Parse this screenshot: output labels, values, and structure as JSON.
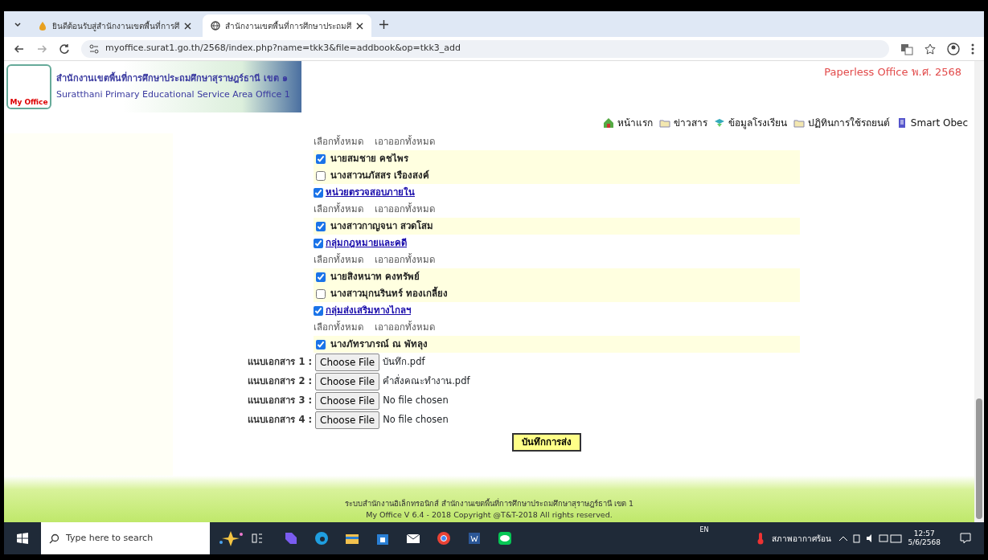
{
  "browser": {
    "tabs": [
      {
        "title": "ยินดีต้อนรับสู่สำนักงานเขตพื้นที่การศึ",
        "selected": false
      },
      {
        "title": "สำนักงานเขตพื้นที่การศึกษาประถมศึ",
        "selected": true
      }
    ],
    "url": "myoffice.surat1.go.th/2568/index.php?name=tkk3&file=addbook&op=tkk3_add"
  },
  "header": {
    "logo_text": "My Office",
    "title_th": "สำนักงานเขตพื้นที่การศึกษาประถมศึกษาสุราษฎร์ธานี เขต ๑",
    "title_en": "Suratthani Primary Educational Service Area Office 1",
    "tagline": "Paperless Office พ.ศ. 2568",
    "nav": [
      {
        "label": "หน้าแรก",
        "kind": "home"
      },
      {
        "label": "ข่าวสาร",
        "kind": "folder"
      },
      {
        "label": "ข้อมูลโรงเรียน",
        "kind": "globe"
      },
      {
        "label": "ปฏิทินการใช้รถยนต์",
        "kind": "folder"
      },
      {
        "label": "Smart Obec",
        "kind": "doc"
      }
    ]
  },
  "groups": [
    {
      "select_all": "เลือกทั้งหมด",
      "deselect_all": "เอาออกทั้งหมด",
      "members": [
        {
          "name": "นายสมชาย คชไพร",
          "checked": true
        },
        {
          "name": "นางสาวนภัสสร เรืองสงค์",
          "checked": false
        }
      ]
    },
    {
      "name": "หน่วยตรวจสอบภายใน",
      "checked": true,
      "select_all": "เลือกทั้งหมด",
      "deselect_all": "เอาออกทั้งหมด",
      "members": [
        {
          "name": "นางสาวกาญจนา สวดโสม",
          "checked": true
        }
      ]
    },
    {
      "name": "กลุ่มกฎหมายและคดี",
      "checked": true,
      "select_all": "เลือกทั้งหมด",
      "deselect_all": "เอาออกทั้งหมด",
      "members": [
        {
          "name": "นายสิงหนาท คงทรัพย์",
          "checked": true
        },
        {
          "name": "นางสาวมุกนรินทร์ ทองเกลี้ยง",
          "checked": false
        }
      ]
    },
    {
      "name": "กลุ่มส่งเสริมทางไกลฯ",
      "checked": true,
      "select_all": "เลือกทั้งหมด",
      "deselect_all": "เอาออกทั้งหมด",
      "members": [
        {
          "name": "นางภัทราภรณ์ ณ พัทลุง",
          "checked": true
        }
      ]
    }
  ],
  "attachments": [
    {
      "label": "แนบเอกสาร 1 :",
      "button": "Choose File",
      "file": "บันทึก.pdf"
    },
    {
      "label": "แนบเอกสาร 2 :",
      "button": "Choose File",
      "file": "คำสั่งคณะทำงาน.pdf"
    },
    {
      "label": "แนบเอกสาร 3 :",
      "button": "Choose File",
      "file": "No file chosen"
    },
    {
      "label": "แนบเอกสาร 4 :",
      "button": "Choose File",
      "file": "No file chosen"
    }
  ],
  "submit": "บันทึกการส่ง",
  "footer": [
    "ระบบสำนักงานอิเล็กทรอนิกส์ สำนักงานเขตพื้นที่การศึกษาประถมศึกษาสุราษฎร์ธานี เขต 1",
    "My Office V 6.4 - 2018 Copyright @T&T-2018 All rights reserved."
  ],
  "taskbar": {
    "search_placeholder": "Type here to search",
    "lang": "EN",
    "weather": "สภาพอากาศร้อน",
    "time": "12:57",
    "date": "5/6/2568"
  }
}
